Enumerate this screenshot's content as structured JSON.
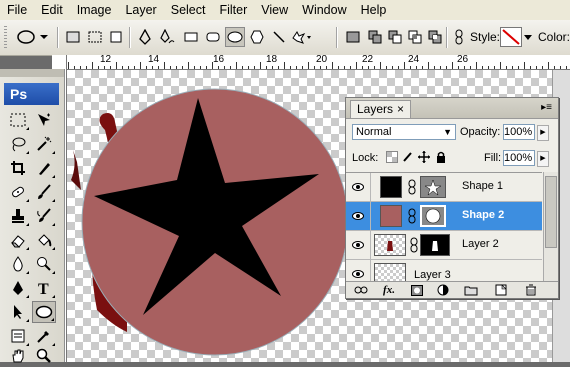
{
  "menu": [
    "File",
    "Edit",
    "Image",
    "Layer",
    "Select",
    "Filter",
    "View",
    "Window",
    "Help"
  ],
  "options": {
    "style_label": "Style:",
    "color_label": "Color:"
  },
  "ruler": {
    "top_numbers": [
      "12",
      "14",
      "16",
      "18",
      "20",
      "22",
      "24",
      "26"
    ]
  },
  "toolbox": {
    "logo": "Ps"
  },
  "layers_panel": {
    "tab_label": "Layers",
    "tab_close": "×",
    "blend_mode": "Normal",
    "opacity_label": "Opacity:",
    "opacity_value": "100%",
    "lock_label": "Lock:",
    "fill_label": "Fill:",
    "fill_value": "100%",
    "layers": [
      {
        "name": "Shape 1",
        "selected": false
      },
      {
        "name": "Shape 2",
        "selected": true
      },
      {
        "name": "Layer 2",
        "selected": false
      },
      {
        "name": "Layer 3",
        "selected": false
      }
    ],
    "fx_label": "fx."
  },
  "colors": {
    "circle": "#a86060",
    "star": "#000000",
    "selection": "#3d8ee0",
    "cloak": "#7a1010"
  }
}
